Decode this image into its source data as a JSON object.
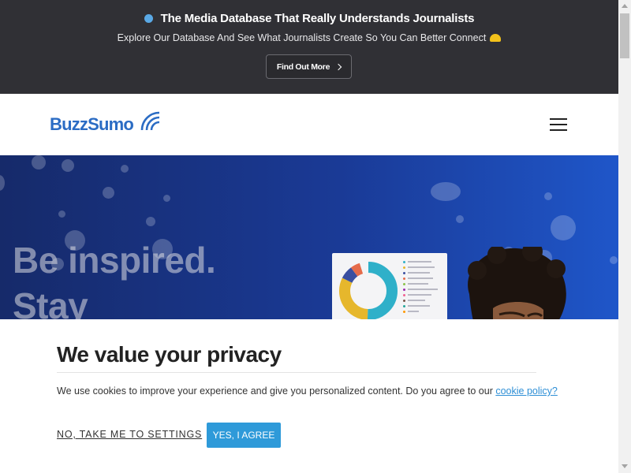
{
  "announcement": {
    "title": "The Media Database That Really Understands Journalists",
    "subtitle": "Explore Our Database And See What Journalists Create So You Can Better Connect",
    "button_label": "Find Out More",
    "dot_color": "#5aa9e6"
  },
  "header": {
    "logo_text": "BuzzSumo",
    "brand_color": "#2b6cc4"
  },
  "hero": {
    "title_line1": "Be inspired.",
    "title_line2": "Stay"
  },
  "cookie": {
    "title": "We value your privacy",
    "text": "We use cookies to improve your experience and give you personalized content. Do you agree to our ",
    "link_text": "cookie policy?",
    "settings_label": "NO, TAKE ME TO SETTINGS",
    "agree_label": "YES, I AGREE",
    "accent_color": "#2e9ad9"
  },
  "icons": {
    "announce_dot": "blue-dot-icon",
    "emoji": "smiling-emoji-icon",
    "button_chevron": "chevron-right-icon",
    "logo_waves": "signal-waves-icon",
    "menu": "hamburger-menu-icon"
  }
}
